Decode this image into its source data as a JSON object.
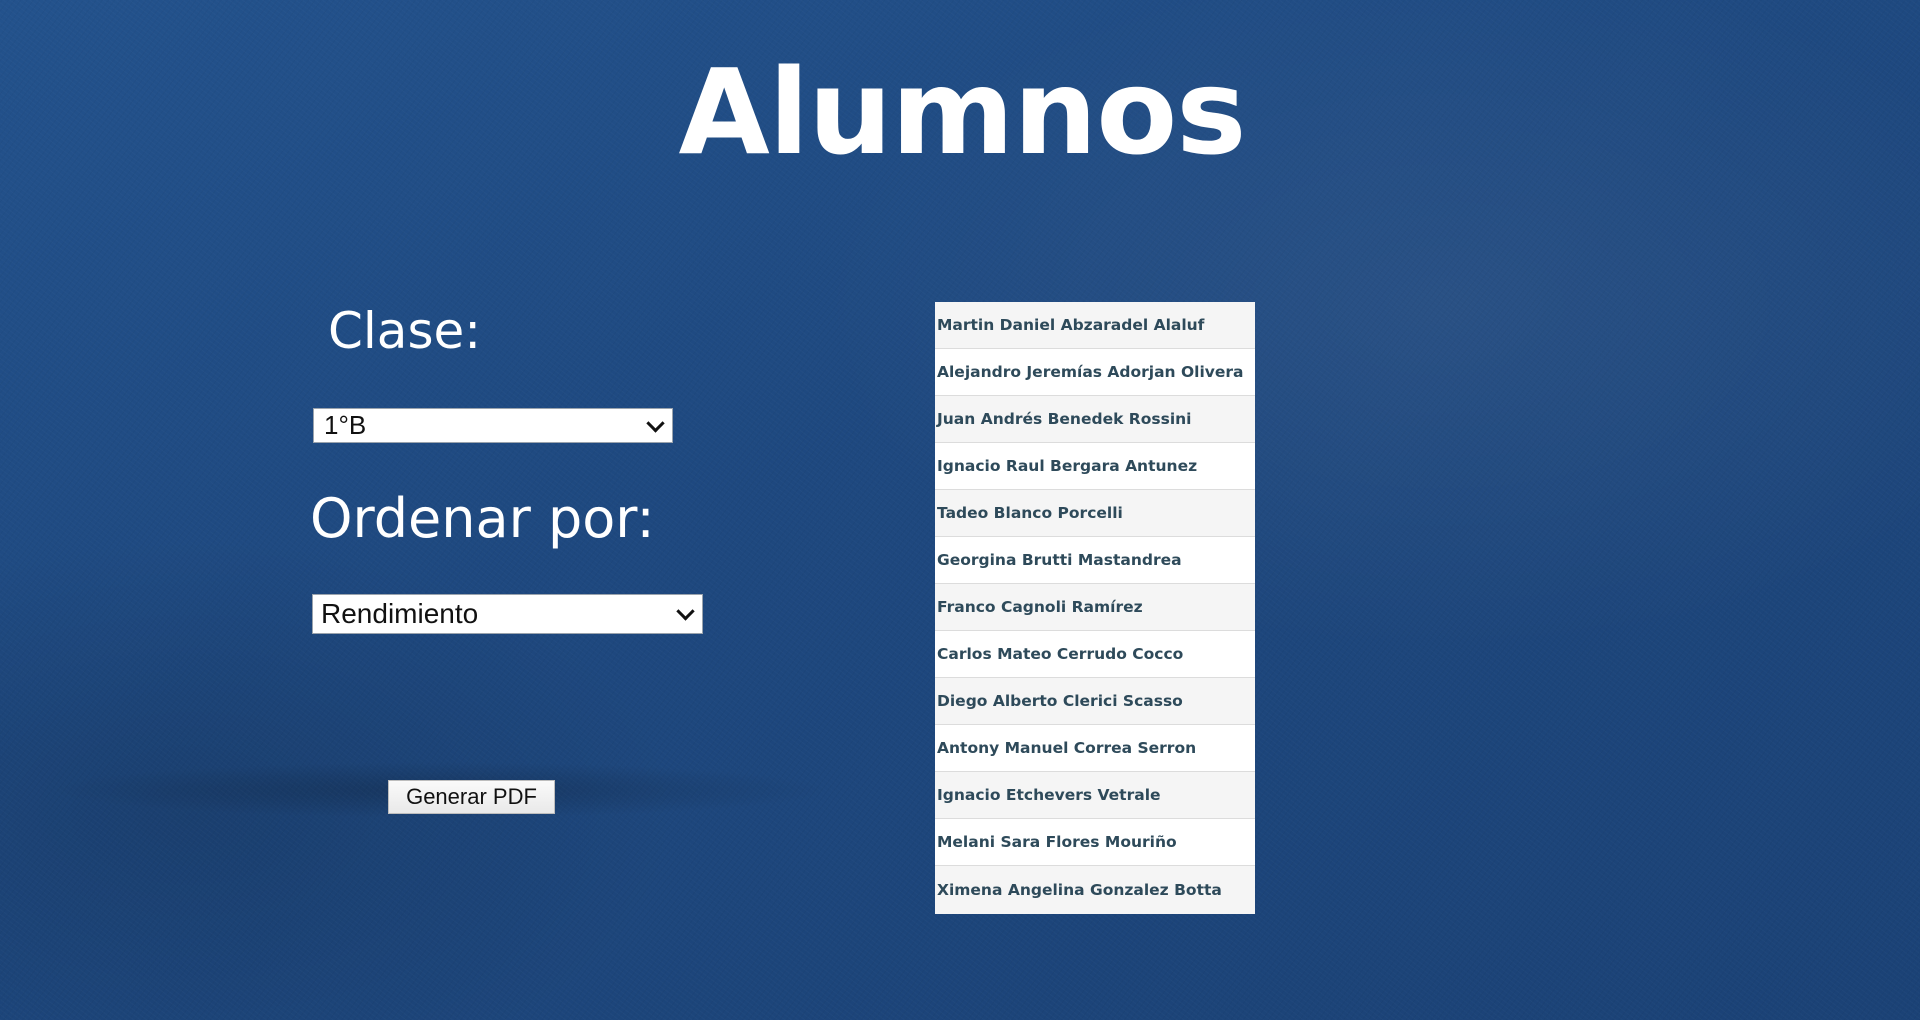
{
  "page": {
    "title": "Alumnos"
  },
  "filters": {
    "clase_label": "Clase:",
    "clase_value": "1°B",
    "orden_label": "Ordenar por:",
    "orden_value": "Rendimiento"
  },
  "actions": {
    "pdf_button": "Generar PDF"
  },
  "students": [
    "Martin Daniel Abzaradel Alaluf",
    "Alejandro Jeremías Adorjan Olivera",
    "Juan Andrés Benedek Rossini",
    "Ignacio Raul Bergara Antunez",
    "Tadeo Blanco Porcelli",
    "Georgina Brutti Mastandrea",
    "Franco Cagnoli Ramírez",
    "Carlos Mateo Cerrudo Cocco",
    "Diego Alberto Clerici Scasso",
    "Antony Manuel Correa Serron",
    "Ignacio Etchevers Vetrale",
    "Melani Sara Flores Mouriño",
    "Ximena Angelina Gonzalez Botta"
  ],
  "colors": {
    "background": "#1f4a80",
    "title_text": "#ffffff",
    "list_text": "#2e4a5a",
    "list_row_alt": "#f5f5f5"
  }
}
